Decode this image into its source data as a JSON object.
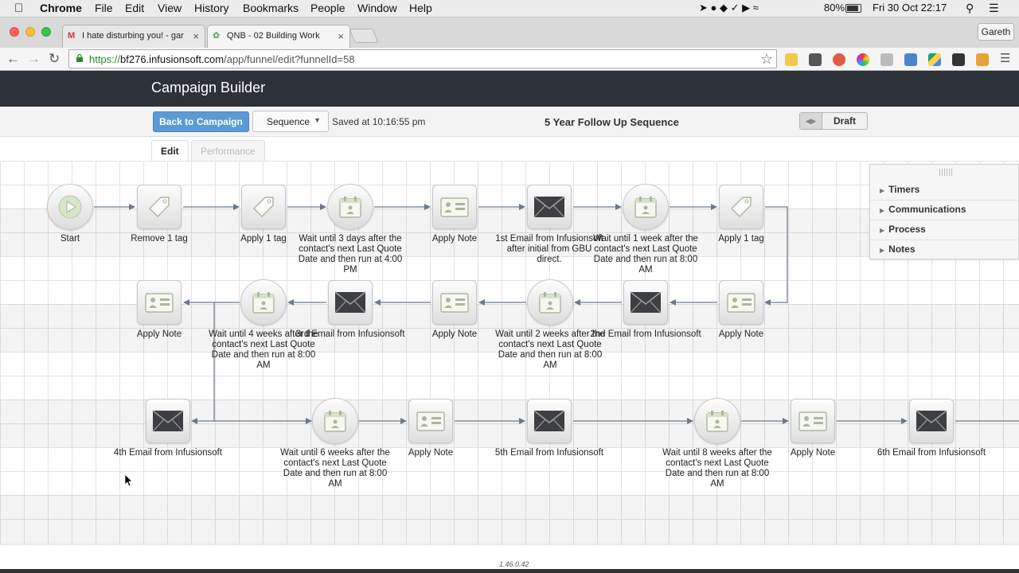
{
  "menubar": {
    "app": "Chrome",
    "items": [
      "File",
      "Edit",
      "View",
      "History",
      "Bookmarks",
      "People",
      "Window",
      "Help"
    ],
    "battery": "80%",
    "clock": "Fri 30 Oct  22:17"
  },
  "browser": {
    "tabs": [
      {
        "title": "I hate disturbing you! - gar"
      },
      {
        "title": "QNB - 02 Building Work"
      }
    ],
    "profile": "Gareth",
    "url": {
      "scheme": "https://",
      "host": "bf276.infusionsoft.com",
      "path": "/app/funnel/edit?funnelId=58"
    }
  },
  "app": {
    "title": "Campaign Builder",
    "back_button": "Back to Campaign",
    "sequence_dropdown": "Sequence",
    "saved_text": "Saved at 10:16:55 pm",
    "sequence_title": "5 Year Follow Up Sequence",
    "status_toggle": "Draft",
    "tabs": {
      "edit": "Edit",
      "performance": "Performance"
    }
  },
  "nodes": [
    {
      "id": "start",
      "type": "start",
      "label": "Start"
    },
    {
      "id": "n1",
      "type": "tag",
      "label": "Remove 1 tag"
    },
    {
      "id": "n2",
      "type": "tag",
      "label": "Apply 1 tag"
    },
    {
      "id": "n3",
      "type": "timer",
      "label": "Wait until 3 days after the contact's next Last Quote Date and then run at 4:00 PM"
    },
    {
      "id": "n4",
      "type": "note",
      "label": "Apply Note"
    },
    {
      "id": "n5",
      "type": "email",
      "label": "1st Email from Infusionsoft after initial from GBU direct."
    },
    {
      "id": "n6",
      "type": "timer",
      "label": "Wait until 1 week after the contact's next Last Quote Date and then run at 8:00 AM"
    },
    {
      "id": "n7",
      "type": "tag",
      "label": "Apply 1 tag"
    },
    {
      "id": "n8",
      "type": "note",
      "label": "Apply Note"
    },
    {
      "id": "n9",
      "type": "email",
      "label": "2nd Email from Infusionsoft"
    },
    {
      "id": "n10",
      "type": "timer",
      "label": "Wait until 2 weeks after the contact's next Last Quote Date and then run at 8:00 AM"
    },
    {
      "id": "n11",
      "type": "note",
      "label": "Apply Note"
    },
    {
      "id": "n12",
      "type": "email",
      "label": "3rd Email from Infusionsoft"
    },
    {
      "id": "n13",
      "type": "timer",
      "label": "Wait until 4 weeks after the contact's next Last Quote Date and then run at 8:00 AM"
    },
    {
      "id": "n14",
      "type": "note",
      "label": "Apply Note"
    },
    {
      "id": "n15",
      "type": "email",
      "label": "4th Email from Infusionsoft"
    },
    {
      "id": "n16",
      "type": "timer",
      "label": "Wait until 6 weeks after the contact's next Last Quote Date and then run at 8:00 AM"
    },
    {
      "id": "n17",
      "type": "note",
      "label": "Apply Note"
    },
    {
      "id": "n18",
      "type": "email",
      "label": "5th Email from Infusionsoft"
    },
    {
      "id": "n19",
      "type": "timer",
      "label": "Wait until 8 weeks after the contact's next Last Quote Date and then run at 8:00 AM"
    },
    {
      "id": "n20",
      "type": "note",
      "label": "Apply Note"
    },
    {
      "id": "n21",
      "type": "email",
      "label": "6th Email from Infusionsoft"
    }
  ],
  "panel": {
    "items": [
      "Timers",
      "Communications",
      "Process",
      "Notes"
    ]
  },
  "footer": {
    "version": "1.46.0.42"
  }
}
